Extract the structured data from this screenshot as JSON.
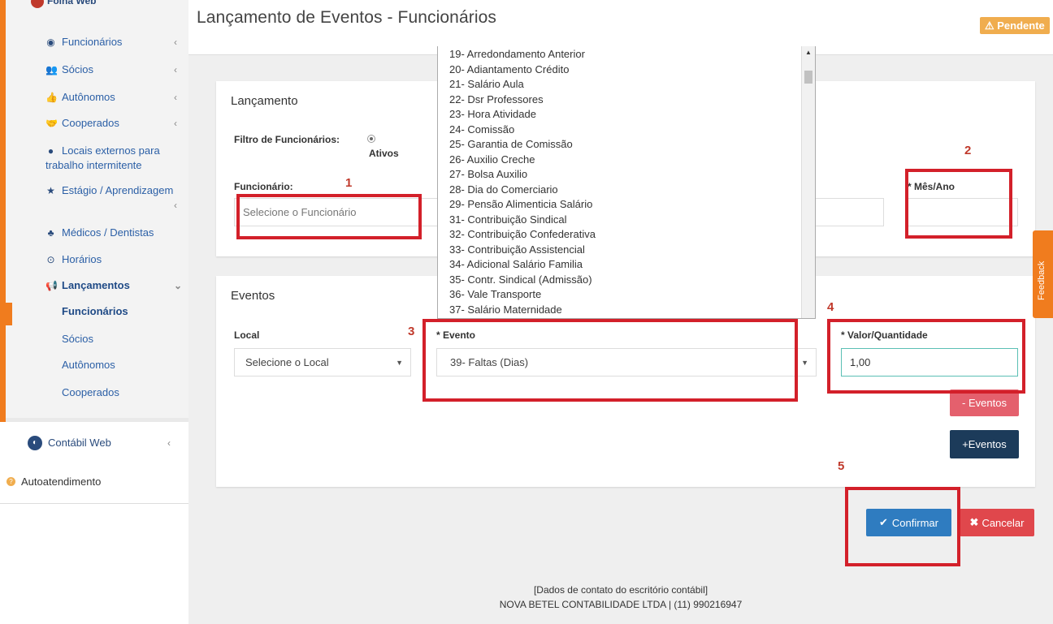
{
  "sidebar": {
    "logo": "Folha Web",
    "items": [
      {
        "icon": "user-circle-icon",
        "label": "Funcionários"
      },
      {
        "icon": "user-plus-icon",
        "label": "Sócios"
      },
      {
        "icon": "thumbs-up-icon",
        "label": "Autônomos"
      },
      {
        "icon": "handshake-icon",
        "label": "Cooperados"
      },
      {
        "icon": "globe-icon",
        "label": "Locais externos para trabalho intermitente"
      },
      {
        "icon": "star-icon",
        "label": "Estágio / Aprendizagem"
      },
      {
        "icon": "user-md-icon",
        "label": "Médicos / Dentistas"
      },
      {
        "icon": "clock-icon",
        "label": "Horários"
      },
      {
        "icon": "bullhorn-icon",
        "label": "Lançamentos"
      }
    ],
    "subitems": [
      "Funcionários",
      "Sócios",
      "Autônomos",
      "Cooperados"
    ],
    "contabil": "Contábil Web",
    "autoatendimento": "Autoatendimento"
  },
  "header": {
    "title": "Lançamento de Eventos - Funcionários",
    "badge": "⚠ Pendente"
  },
  "lancamento": {
    "title": "Lançamento",
    "filtro_label": "Filtro de Funcionários:",
    "filtro_option": "Ativos",
    "funcionario_label": "Funcionário:",
    "funcionario_placeholder": "Selecione o Funcionário",
    "mes_ano_label": "* Mês/Ano"
  },
  "eventos": {
    "title": "Eventos",
    "local_label": "Local",
    "local_value": "Selecione o Local",
    "evento_label": "* Evento",
    "evento_value": "39- Faltas (Dias)",
    "valor_label": "* Valor/Quantidade",
    "valor_value": "1,00",
    "minus_button": "- Eventos",
    "plus_button": "+Eventos"
  },
  "dropdown_options": [
    "19- Arredondamento Anterior",
    "20- Adiantamento Crédito",
    "21- Salário Aula",
    "22- Dsr Professores",
    "23- Hora Atividade",
    "24- Comissão",
    "25- Garantia de Comissão",
    "26- Auxilio Creche",
    "27- Bolsa Auxilio",
    "28- Dia do Comerciario",
    "29- Pensão Alimenticia Salário",
    "31- Contribuição Sindical",
    "32- Contribuição Confederativa",
    "33- Contribuição Assistencial",
    "34- Adicional Salário Familia",
    "35- Contr. Sindical (Admissão)",
    "36- Vale Transporte",
    "37- Salário Maternidade"
  ],
  "actions": {
    "confirm": "Confirmar",
    "cancel": "Cancelar"
  },
  "annotations": [
    "1",
    "2",
    "3",
    "4",
    "5"
  ],
  "feedback": "Feedback",
  "footer": {
    "line1": "[Dados de contato do escritório contábil]",
    "line2": "NOVA BETEL CONTABILIDADE LTDA | (11) 990216947"
  },
  "colors": {
    "accent": "#f07c1e",
    "link": "#2b5fa6",
    "annotation": "#d3202a",
    "confirm": "#2f7cc0",
    "cancel": "#e0474c"
  }
}
